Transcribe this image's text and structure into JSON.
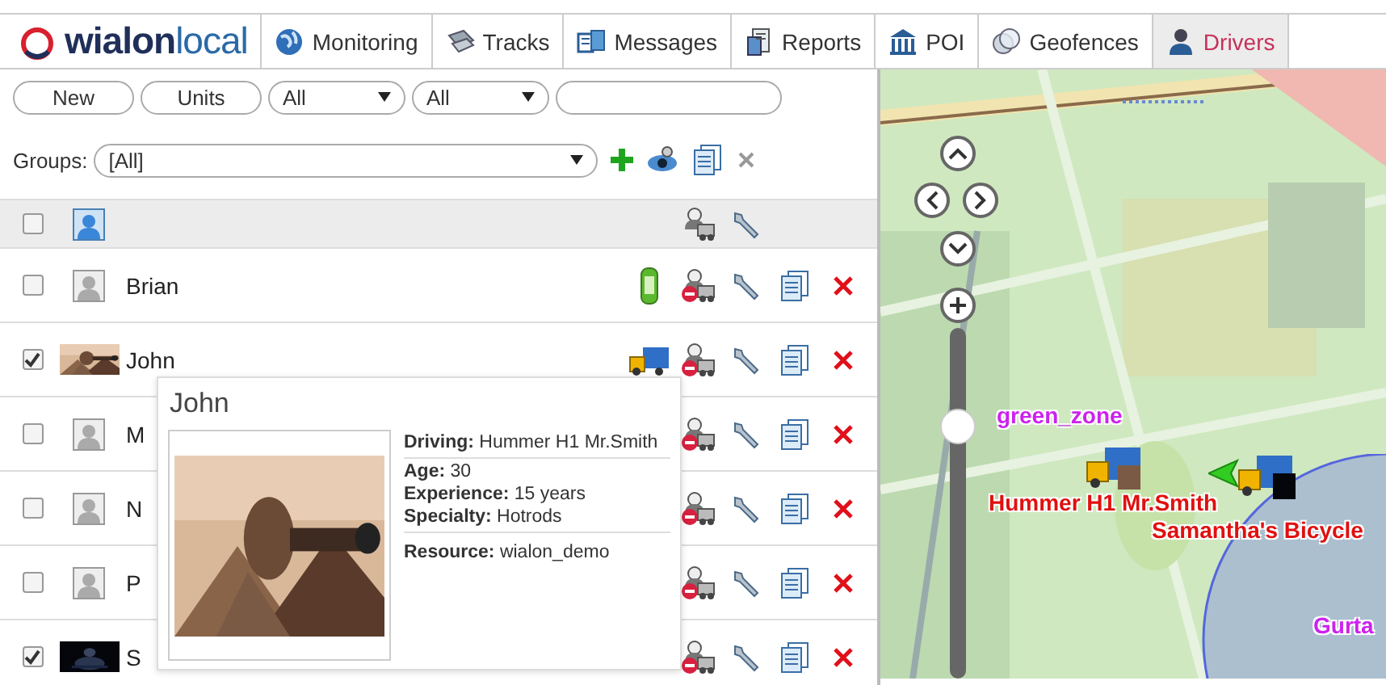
{
  "logo": {
    "brand": "wialon",
    "suffix": "local"
  },
  "tabs": [
    {
      "label": "Monitoring",
      "selected": false
    },
    {
      "label": "Tracks",
      "selected": false
    },
    {
      "label": "Messages",
      "selected": false
    },
    {
      "label": "Reports",
      "selected": false
    },
    {
      "label": "POI",
      "selected": false
    },
    {
      "label": "Geofences",
      "selected": false
    },
    {
      "label": "Drivers",
      "selected": true
    }
  ],
  "toolbar": {
    "buttons": [
      "New",
      "Units"
    ],
    "selects": [
      "All",
      "All"
    ],
    "groups_label": "Groups:",
    "groups_value": "[All]"
  },
  "header_row": {
    "checked": false
  },
  "rows": [
    {
      "name": "Brian",
      "checked": false,
      "avatar": {
        "kind": "silhouette"
      },
      "unit": {
        "kind": "car"
      }
    },
    {
      "name": "John",
      "checked": true,
      "unit": {
        "kind": "truck"
      }
    },
    {
      "name": "M",
      "checked": false,
      "avatar": {
        "kind": "silhouette"
      }
    },
    {
      "name": "N",
      "checked": false,
      "avatar": {
        "kind": "silhouette"
      }
    },
    {
      "name": "P",
      "checked": false,
      "avatar": {
        "kind": "silhouette"
      }
    },
    {
      "name": "S",
      "checked": true
    }
  ],
  "tooltip": {
    "title": "John",
    "sections": [
      [
        {
          "label": "Driving:",
          "value": "Hummer H1 Mr.Smith"
        }
      ],
      [
        {
          "label": "Age:",
          "value": "30"
        },
        {
          "label": "Experience:",
          "value": "15 years"
        },
        {
          "label": "Specialty:",
          "value": "Hotrods"
        }
      ],
      [
        {
          "label": "Resource:",
          "value": "wialon_demo"
        }
      ]
    ]
  },
  "map": {
    "zoom": {
      "level": 0.72
    },
    "geofences": [
      {
        "label": "green_zone",
        "color": "#cc22ee"
      },
      {
        "label": "Gurta",
        "color": "#cc22ee"
      }
    ],
    "units": [
      {
        "label": "Hummer H1 Mr.Smith"
      },
      {
        "label": "Samantha's Bicycle"
      }
    ]
  }
}
